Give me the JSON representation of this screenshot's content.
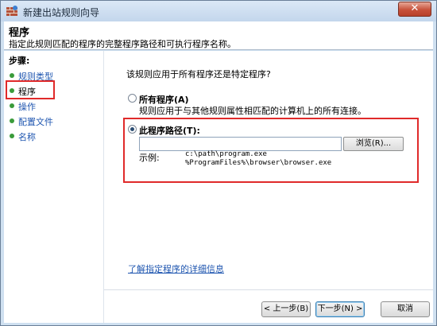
{
  "window": {
    "title": "新建出站规则向导",
    "close_label": "✕",
    "colors": {
      "highlight_red": "#e02a2a",
      "link_blue": "#1f56b0",
      "step_dot_green": "#3a9b3a"
    }
  },
  "header": {
    "title": "程序",
    "subtitle": "指定此规则匹配的程序的完整程序路径和可执行程序名称。"
  },
  "steps": {
    "title": "步骤:",
    "items": [
      {
        "label": "规则类型"
      },
      {
        "label": "程序"
      },
      {
        "label": "操作"
      },
      {
        "label": "配置文件"
      },
      {
        "label": "名称"
      }
    ]
  },
  "main": {
    "question": "该规则应用于所有程序还是特定程序?",
    "option_all": {
      "label": "所有程序(A)",
      "description": "规则应用于与其他规则属性相匹配的计算机上的所有连接。",
      "selected": false
    },
    "option_path": {
      "label": "此程序路径(T):",
      "selected": true,
      "input_value": "",
      "browse_label": "浏览(R)...",
      "example_label": "示例:",
      "example_1": "c:\\path\\program.exe",
      "example_2": "%ProgramFiles%\\browser\\browser.exe"
    },
    "learn_more_link": "了解指定程序的详细信息"
  },
  "footer": {
    "back_label": "< 上一步(B)",
    "next_label": "下一步(N) >",
    "cancel_label": "取消"
  }
}
